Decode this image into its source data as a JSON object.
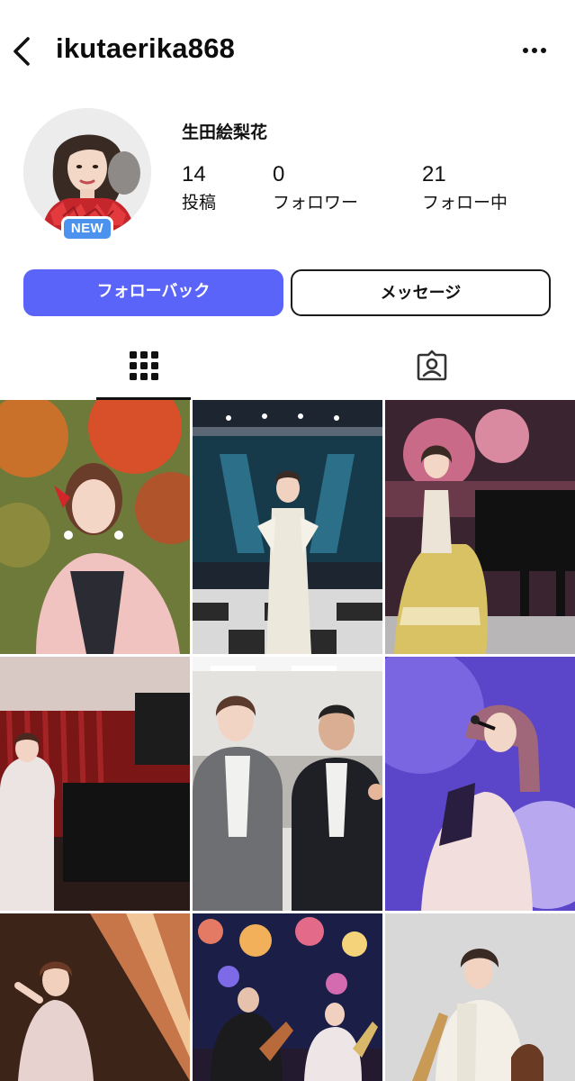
{
  "header": {
    "username": "ikutaerika868",
    "back_icon": "chevron-left-icon",
    "more_icon": "more-horizontal-icon"
  },
  "profile": {
    "display_name": "生田絵梨花",
    "badge": "NEW",
    "stats": [
      {
        "value": "14",
        "label": "投稿"
      },
      {
        "value": "0",
        "label": "フォロワー"
      },
      {
        "value": "21",
        "label": "フォロー中"
      }
    ]
  },
  "actions": {
    "follow_back": "フォローバック",
    "message": "メッセージ",
    "accent_color": "#5a64f8"
  },
  "tabs": [
    {
      "icon": "grid-icon",
      "active": true
    },
    {
      "icon": "tagged-person-icon",
      "active": false
    }
  ],
  "posts": [
    {
      "scene": "autumn-leaves-portrait"
    },
    {
      "scene": "stage-white-dress"
    },
    {
      "scene": "piano-pink-stage"
    },
    {
      "scene": "red-curtain-piano"
    },
    {
      "scene": "office-duo-photo"
    },
    {
      "scene": "purple-concert-singer"
    },
    {
      "scene": "stage-spotlight-dancer"
    },
    {
      "scene": "band-guitar-lights"
    },
    {
      "scene": "violin-white-outfit"
    }
  ]
}
